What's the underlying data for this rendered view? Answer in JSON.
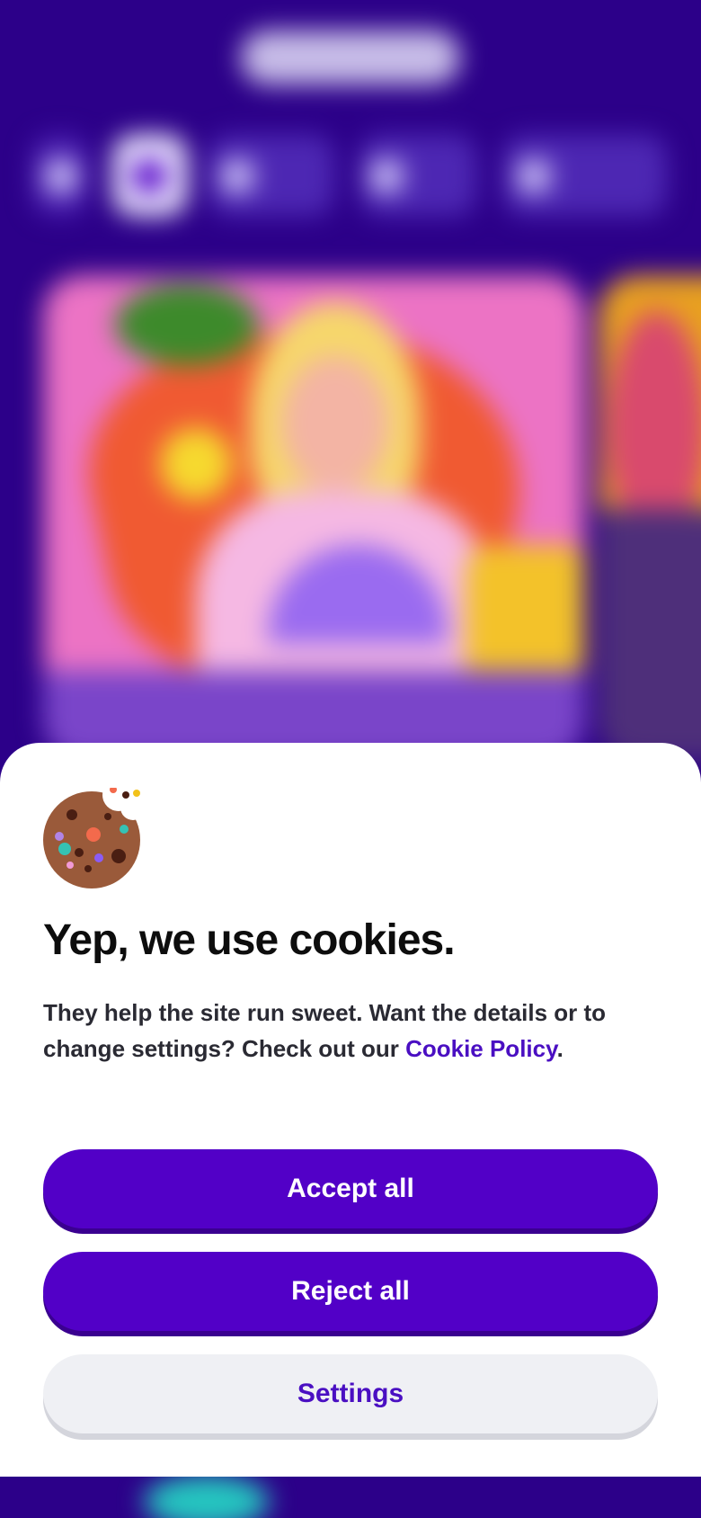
{
  "background": {
    "description_hidden": true
  },
  "cookie_banner": {
    "icon": "cookie-icon",
    "title": "Yep, we use cookies.",
    "body_prefix": "They help the site run sweet. Want the details or to change settings? Check out our ",
    "policy_link": "Cookie Policy",
    "body_suffix": ".",
    "accept_label": "Accept all",
    "reject_label": "Reject all",
    "settings_label": "Settings"
  },
  "colors": {
    "brand_purple": "#5200c7",
    "link_purple": "#4a0fc2",
    "background_purple": "#2c0089",
    "secondary_button": "#eff0f4"
  }
}
